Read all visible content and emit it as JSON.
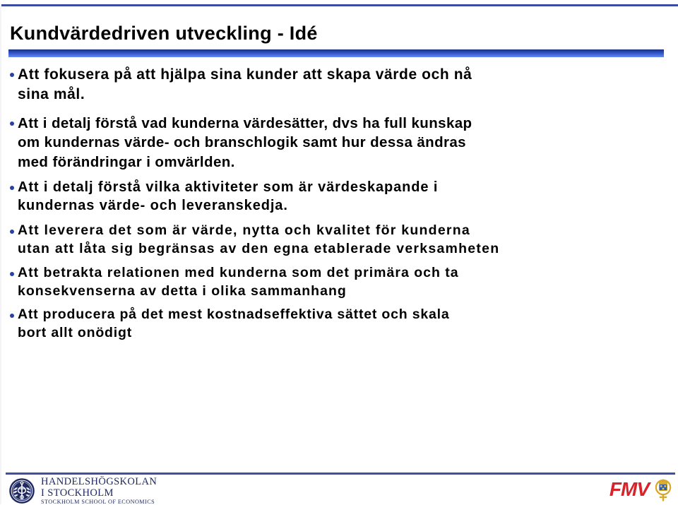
{
  "slide": {
    "title": "Kundvärdedriven utveckling - Idé",
    "bullets": [
      {
        "text": "Att fokusera på att hjälpa sina kunder att skapa värde och nå\nsina mål."
      },
      {
        "text": "Att i detalj förstå vad kunderna värdesätter, dvs ha full kunskap\nom kundernas värde- och branschlogik samt hur dessa ändras\nmed förändringar i omvärlden."
      },
      {
        "text": "Att i detalj förstå vilka aktiviteter som är värdeskapande i\nkundernas värde- och leveranskedja."
      },
      {
        "text": "Att leverera det som är värde, nytta och kvalitet för kunderna\nutan att låta sig begränsas av den egna etablerade verksamheten"
      },
      {
        "text": "Att betrakta relationen med kunderna som det primära och ta\nkonsekvenserna av detta i olika sammanhang"
      },
      {
        "text": "Att producera på det mest kostnadseffektiva sättet och skala\nbort allt onödigt"
      }
    ]
  },
  "footer": {
    "sse": {
      "line1": "HANDELSHÖGSKOLAN",
      "line2": "I STOCKHOLM",
      "line3": "STOCKHOLM SCHOOL OF ECONOMICS"
    },
    "fmv": {
      "wordmark": "FMV"
    }
  },
  "colors": {
    "rule_blue": "#3b4ba0",
    "bar_gradient_top": "#1b2f7a",
    "bar_gradient_bottom": "#6a8bf2",
    "bullet_blue": "#2b3fa8",
    "title_black": "#000000",
    "sse_navy": "#1f2a62",
    "fmv_red": "#d8232a",
    "fmv_gold": "#d9a628"
  }
}
